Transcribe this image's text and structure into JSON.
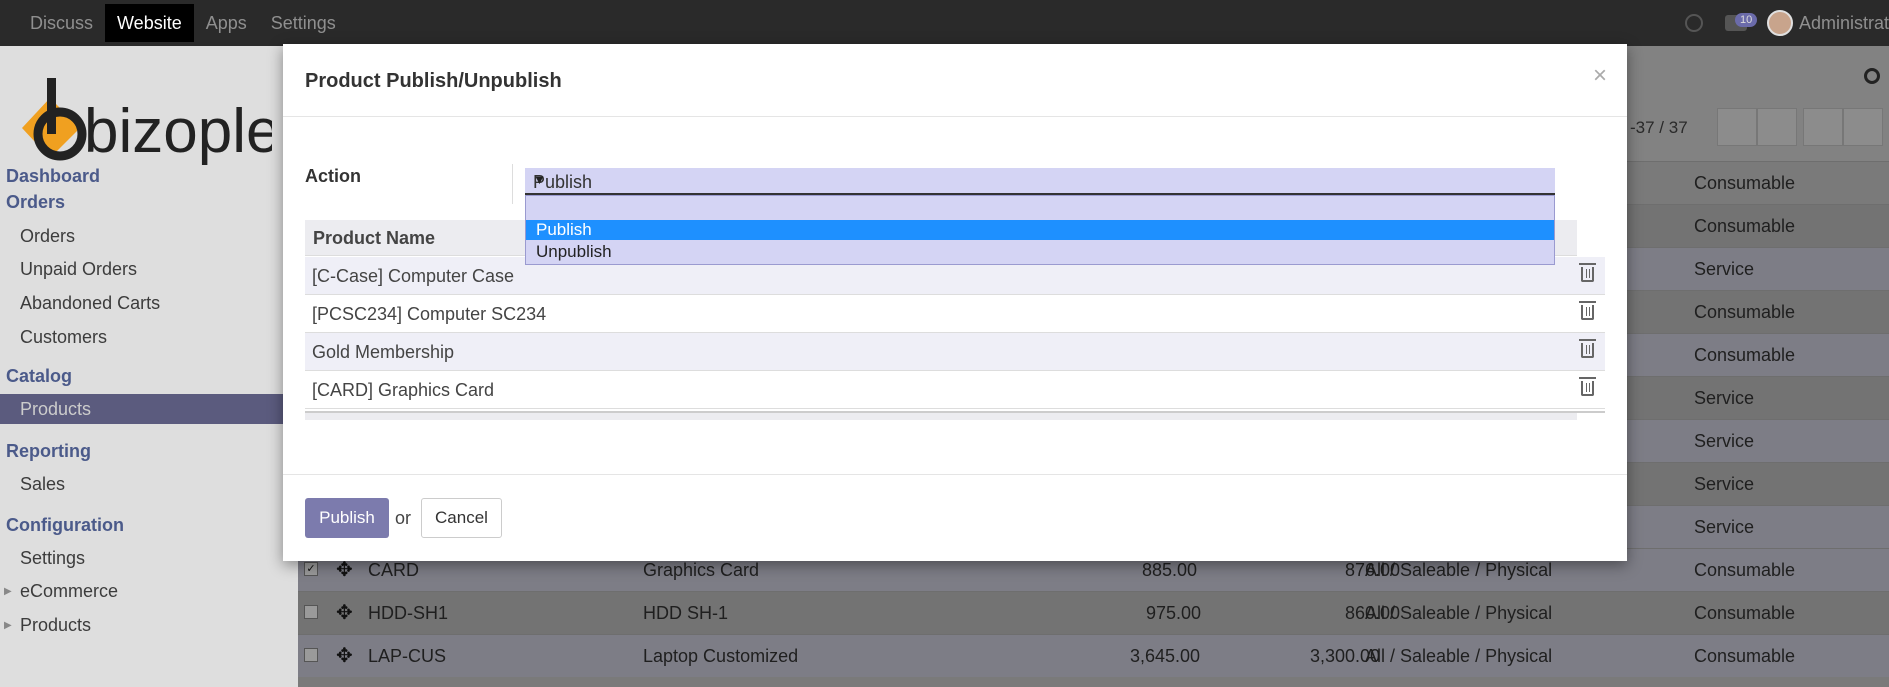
{
  "topbar": {
    "menu": [
      "Discuss",
      "Website",
      "Apps",
      "Settings"
    ],
    "active": "Website",
    "chat_badge": "10",
    "user": "Administrat"
  },
  "sidebar": {
    "logo_text": "bizople",
    "sections": {
      "dashboard": "Dashboard",
      "orders": "Orders",
      "catalog": "Catalog",
      "reporting": "Reporting",
      "configuration": "Configuration"
    },
    "items": {
      "orders": "Orders",
      "unpaid_orders": "Unpaid Orders",
      "abandoned_carts": "Abandoned Carts",
      "customers": "Customers",
      "products": "Products",
      "sales": "Sales",
      "settings": "Settings",
      "ecommerce": "eCommerce",
      "products2": "Products"
    }
  },
  "list": {
    "pager": "-37 / 37",
    "types": [
      "Consumable",
      "Consumable",
      "Service",
      "Consumable",
      "Consumable",
      "Service",
      "Service",
      "Service",
      "Service"
    ],
    "visible_rows": [
      {
        "ref": "CARD",
        "name": "Graphics Card",
        "price": "885.00",
        "cost": "876.00",
        "category": "All / Saleable / Physical",
        "type": "Consumable",
        "checked": true
      },
      {
        "ref": "HDD-SH1",
        "name": "HDD SH-1",
        "price": "975.00",
        "cost": "860.00",
        "category": "All / Saleable / Physical",
        "type": "Consumable",
        "checked": false
      },
      {
        "ref": "LAP-CUS",
        "name": "Laptop Customized",
        "price": "3,645.00",
        "cost": "3,300.00",
        "category": "All / Saleable / Physical",
        "type": "Consumable",
        "checked": false
      }
    ]
  },
  "modal": {
    "title": "Product Publish/Unpublish",
    "close": "×",
    "action_label": "Action",
    "action_value": "Publish",
    "options": [
      "",
      "Publish",
      "Unpublish"
    ],
    "column_header": "Product Name",
    "products": [
      "[C-Case] Computer Case",
      "[PCSC234] Computer SC234",
      "Gold Membership",
      "[CARD] Graphics Card"
    ],
    "publish_button": "Publish",
    "or_text": "or",
    "cancel_button": "Cancel"
  }
}
